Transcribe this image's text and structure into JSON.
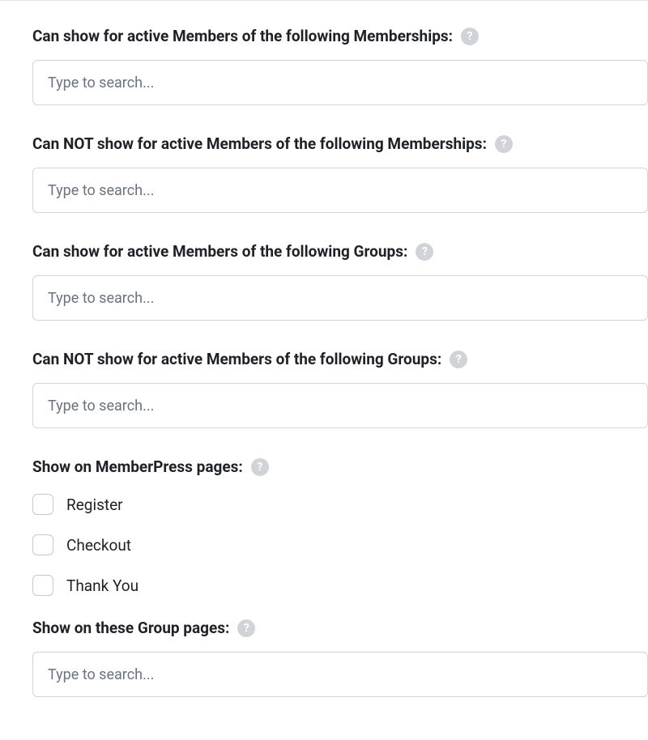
{
  "fields": {
    "show_memberships": {
      "label": "Can show for active Members of the following Memberships:",
      "placeholder": "Type to search..."
    },
    "not_show_memberships": {
      "label": "Can NOT show for active Members of the following Memberships:",
      "placeholder": "Type to search..."
    },
    "show_groups": {
      "label": "Can show for active Members of the following Groups:",
      "placeholder": "Type to search..."
    },
    "not_show_groups": {
      "label": "Can NOT show for active Members of the following Groups:",
      "placeholder": "Type to search..."
    },
    "memberpress_pages": {
      "label": "Show on MemberPress pages:",
      "options": {
        "register": "Register",
        "checkout": "Checkout",
        "thank_you": "Thank You"
      }
    },
    "group_pages": {
      "label": "Show on these Group pages:",
      "placeholder": "Type to search..."
    }
  },
  "help_glyph": "?"
}
